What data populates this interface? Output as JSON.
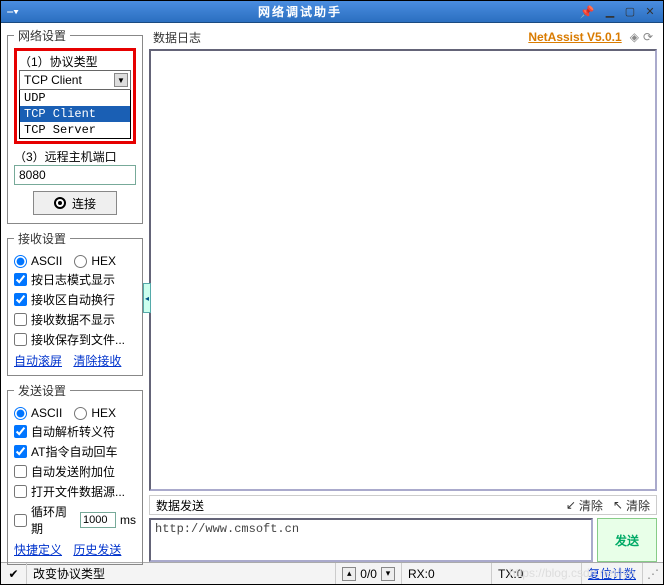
{
  "window": {
    "title": "网络调试助手"
  },
  "brand": {
    "name": "NetAssist V5.0.1"
  },
  "network": {
    "legend": "网络设置",
    "protocol_label": "（1）协议类型",
    "protocol_selected": "TCP Client",
    "protocol_options": {
      "udp": "UDP",
      "tcp_client": "TCP Client",
      "tcp_server": "TCP Server"
    },
    "port_label": "（3）远程主机端口",
    "port_value": "8080",
    "connect_label": "连接"
  },
  "recv": {
    "legend": "接收设置",
    "ascii": "ASCII",
    "hex": "HEX",
    "opt1": "按日志模式显示",
    "opt2": "接收区自动换行",
    "opt3": "接收数据不显示",
    "opt4": "接收保存到文件...",
    "link1": "自动滚屏",
    "link2": "清除接收"
  },
  "send": {
    "legend": "发送设置",
    "ascii": "ASCII",
    "hex": "HEX",
    "opt1": "自动解析转义符",
    "opt2": "AT指令自动回车",
    "opt3": "自动发送附加位",
    "opt4": "打开文件数据源...",
    "cycle": "循环周期",
    "cycle_val": "1000",
    "cycle_unit": "ms",
    "link1": "快捷定义",
    "link2": "历史发送"
  },
  "log": {
    "label": "数据日志"
  },
  "sendbox": {
    "label": "数据发送",
    "clear_down": "清除",
    "clear_up": "清除",
    "value": "http://www.cmsoft.cn",
    "button": "发送"
  },
  "status": {
    "msg": "改变协议类型",
    "counter": "0/0",
    "rx": "RX:0",
    "tx": "TX:0",
    "reset": "复位计数"
  },
  "watermark": "https://blog.csdn.net/lyn"
}
